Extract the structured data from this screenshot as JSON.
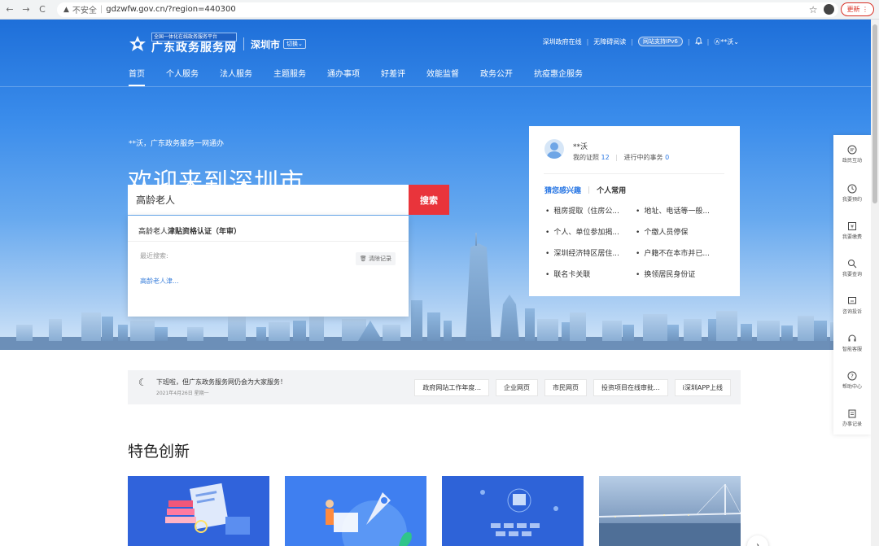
{
  "browser": {
    "back": "←",
    "forward": "→",
    "reload": "C",
    "insecure": "不安全",
    "url": "gdzwfw.gov.cn/?region=440300",
    "update_label": "更新"
  },
  "header": {
    "logo_badge": "全国一体化在线政务服务平台",
    "logo_name": "广东政务服务网",
    "city": "深圳市",
    "switch_label": "切换",
    "top_links": [
      "深圳政府在线",
      "无障碍阅读"
    ],
    "ipv6_badge": "网站支持IPv6",
    "user": "**沃"
  },
  "nav": {
    "items": [
      "首页",
      "个人服务",
      "法人服务",
      "主题服务",
      "通办事项",
      "好差评",
      "效能监督",
      "政务公开",
      "抗疫惠企服务"
    ]
  },
  "hero": {
    "greeting": "**沃，广东政务服务一网通办",
    "welcome": "欢迎来到深圳市"
  },
  "search": {
    "value": "高龄老人",
    "button_label": "搜索",
    "suggestion_prefix": "高龄老人",
    "suggestion_rest": "津贴资格认证（年审）",
    "recent_label": "最近搜索:",
    "clear_label": "清除记录",
    "recent_item": "高龄老人津..."
  },
  "user_card": {
    "name": "**沃",
    "cert_label": "我的证照",
    "cert_count": "12",
    "progress_label": "进行中的事务",
    "progress_count": "0",
    "tab_interest": "猜您感兴趣",
    "tab_common": "个人常用",
    "links": [
      "租房提取（住房公...",
      "地址、电话等一般...",
      "个人、单位参加揭...",
      "个缴人员停保",
      "深圳经济特区居住...",
      "户籍不在本市并已...",
      "联名卡关联",
      "换领居民身份证"
    ]
  },
  "side_toolbar": {
    "items": [
      "政民互动",
      "我要预约",
      "我要缴费",
      "我要查询",
      "咨询投诉",
      "智能客服",
      "帮助中心",
      "办事记录"
    ]
  },
  "notice": {
    "title": "下班啦，但广东政务服务网仍会为大家服务！",
    "date": "2021年4月26日 星期一",
    "chips": [
      "政府网站工作年度...",
      "企业网页",
      "市民网页",
      "投资项目在线审批...",
      "i深圳APP上线"
    ]
  },
  "section": {
    "title": "特色创新"
  },
  "colors": {
    "brand_blue": "#1e6fd9",
    "search_red": "#e9343b",
    "link_blue": "#2b78e4"
  }
}
